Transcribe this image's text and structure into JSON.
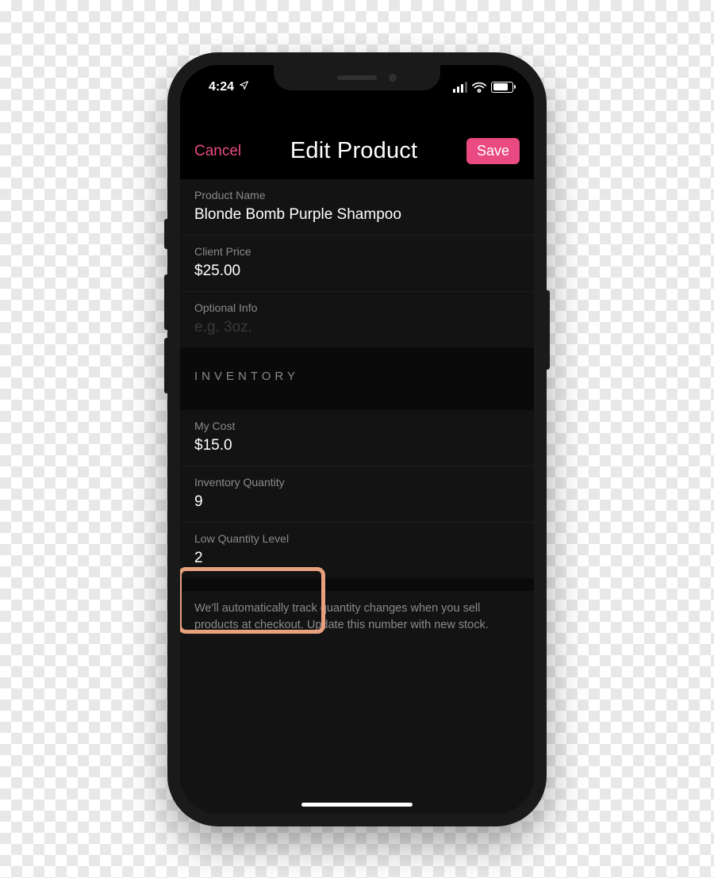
{
  "status": {
    "time": "4:24",
    "location_icon": "location-arrow"
  },
  "nav": {
    "cancel": "Cancel",
    "title": "Edit Product",
    "save": "Save"
  },
  "fields": {
    "product_name": {
      "label": "Product Name",
      "value": "Blonde Bomb Purple Shampoo"
    },
    "client_price": {
      "label": "Client Price",
      "value": "$25.00"
    },
    "optional_info": {
      "label": "Optional Info",
      "placeholder": "e.g. 3oz."
    },
    "my_cost": {
      "label": "My Cost",
      "value": "$15.0"
    },
    "inventory_qty": {
      "label": "Inventory Quantity",
      "value": "9"
    },
    "low_qty_level": {
      "label": "Low Quantity Level",
      "value": "2"
    }
  },
  "sections": {
    "inventory": "INVENTORY"
  },
  "note": "We'll automatically track quantity changes when you sell products at checkout. Update this number with new stock."
}
